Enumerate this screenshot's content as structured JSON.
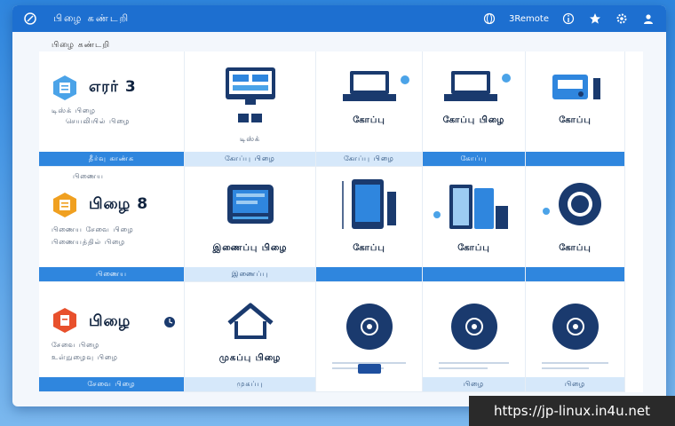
{
  "titlebar": {
    "title": "பிழை கண்டறி",
    "right_label": "3Remote",
    "colors": {
      "bar": "#1d6fd0",
      "accent": "#2f86de"
    }
  },
  "breadcrumb": "பிழை கண்டறி",
  "rows": [
    {
      "header": {
        "title": "எரர் 3",
        "sub1": "டிஸ்க் பிழை",
        "sub2": "செயலியில் பிழை",
        "strip": "தீர்வு காண்க"
      },
      "tiles": [
        {
          "caption": "டிஸ்க்",
          "strip": "கோப்பு பிழை"
        },
        {
          "caption": "கோப்பு",
          "strip": "கோப்பு பிழை"
        },
        {
          "caption": "கோப்பு பிழை",
          "strip": "கோப்பு"
        },
        {
          "caption": "கோப்பு",
          "strip": ""
        }
      ]
    },
    {
      "header": {
        "title": "பிழை 8",
        "sub1": "பிணைய சேவை பிழை",
        "sub2": "பிணையத்தில் பிழை",
        "strip": "பிணைய"
      },
      "tiles": [
        {
          "caption": "இணைப்பு பிழை",
          "strip": "இணைப்பு"
        },
        {
          "caption": "கோப்பு",
          "strip": ""
        },
        {
          "caption": "கோப்பு",
          "strip": ""
        },
        {
          "caption": "கோப்பு",
          "strip": ""
        }
      ]
    },
    {
      "header": {
        "title": "பிழை",
        "sub1": "சேவை பிழை",
        "sub2": "உள்நுழைவு பிழை",
        "strip": "சேவை பிழை"
      },
      "tiles": [
        {
          "caption": "முகப்பு பிழை",
          "strip": "முகப்பு"
        },
        {
          "caption": "",
          "strip": ""
        },
        {
          "caption": "",
          "strip": "பிழை"
        },
        {
          "caption": "",
          "strip": "பிழை"
        }
      ]
    }
  ],
  "watermark": "https://jp-linux.in4u.net"
}
